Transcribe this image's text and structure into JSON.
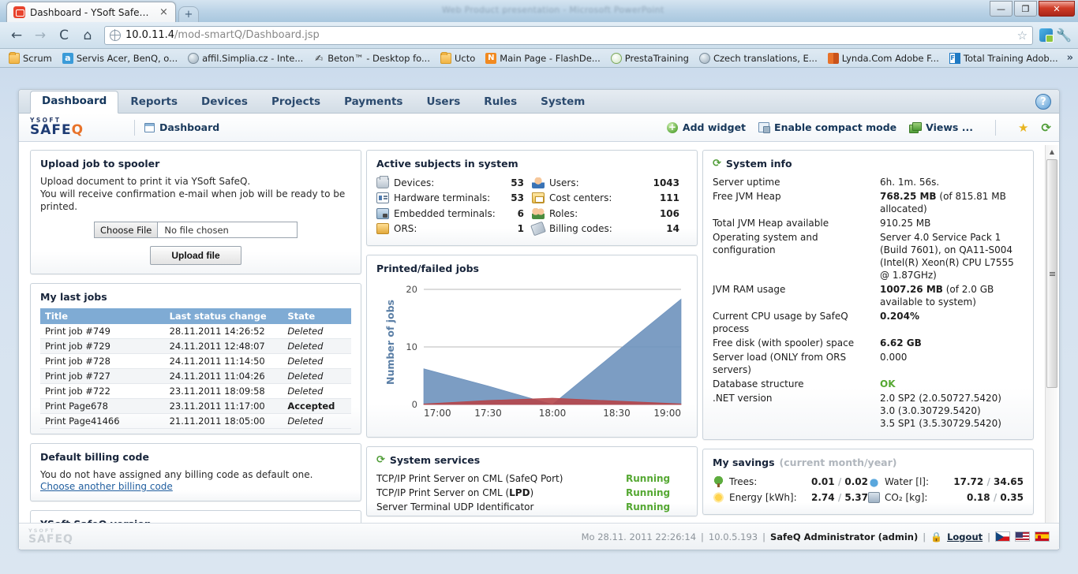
{
  "browser": {
    "tab_title": "Dashboard - YSoft SafeQ®",
    "tab_close": "×",
    "new_tab": "+",
    "ghost_window_title": "Web Product presentation - Microsoft PowerPoint",
    "window_minimize": "—",
    "window_restore": "❐",
    "window_close": "✕",
    "back": "←",
    "forward": "→",
    "reload": "C",
    "home": "⌂",
    "url_host": "10.0.11.4",
    "url_path": "/mod-smartQ/Dashboard.jsp",
    "star": "☆",
    "wrench": "🔧",
    "bookmarks_overflow": "»",
    "bookmarks": [
      {
        "label": "Scrum",
        "icon": "folder-icon",
        "glyph": ""
      },
      {
        "label": "Servis Acer, BenQ, o...",
        "icon": "amazon-icon",
        "glyph": "a"
      },
      {
        "label": "affil.Simplia.cz - Inte...",
        "icon": "globe-icon",
        "glyph": ""
      },
      {
        "label": "Beton™ - Desktop fo...",
        "icon": "hand-icon",
        "glyph": "✍"
      },
      {
        "label": "Ucto",
        "icon": "folder-icon",
        "glyph": ""
      },
      {
        "label": "Main Page - FlashDe...",
        "icon": "flash-icon",
        "glyph": "N"
      },
      {
        "label": "PrestaTraining",
        "icon": "presta-icon",
        "glyph": ""
      },
      {
        "label": "Czech translations, E...",
        "icon": "globe-icon",
        "glyph": ""
      },
      {
        "label": "Lynda.Com Adobe F...",
        "icon": "lynda-icon",
        "glyph": ""
      },
      {
        "label": "Total Training Adob...",
        "icon": "ft-icon",
        "glyph": "FT"
      }
    ]
  },
  "app": {
    "tabs": [
      {
        "label": "Dashboard",
        "active": true
      },
      {
        "label": "Reports",
        "active": false
      },
      {
        "label": "Devices",
        "active": false
      },
      {
        "label": "Projects",
        "active": false
      },
      {
        "label": "Payments",
        "active": false
      },
      {
        "label": "Users",
        "active": false
      },
      {
        "label": "Rules",
        "active": false
      },
      {
        "label": "System",
        "active": false
      }
    ],
    "help_label": "?",
    "logo_top": "YSOFT",
    "logo_bottom": "SAFEQ",
    "breadcrumb": "Dashboard",
    "toolbar": {
      "add_widget": "Add widget",
      "enable_compact_mode": "Enable compact mode",
      "views": "Views ..."
    }
  },
  "upload_widget": {
    "title": "Upload job to spooler",
    "line1": "Upload document to print it via YSoft SafeQ.",
    "line2": "You will receive confirmation e-mail when job will be ready to be printed.",
    "choose_file_label": "Choose File",
    "file_name": "No file chosen",
    "upload_button": "Upload file"
  },
  "last_jobs": {
    "title": "My last jobs",
    "columns": [
      "Title",
      "Last status change",
      "State"
    ],
    "rows": [
      {
        "title": "Print job #749",
        "changed": "28.11.2011 14:26:52",
        "state": "Deleted",
        "accepted": false
      },
      {
        "title": "Print job #729",
        "changed": "24.11.2011 12:48:07",
        "state": "Deleted",
        "accepted": false
      },
      {
        "title": "Print job #728",
        "changed": "24.11.2011 11:14:50",
        "state": "Deleted",
        "accepted": false
      },
      {
        "title": "Print job #727",
        "changed": "24.11.2011 11:04:26",
        "state": "Deleted",
        "accepted": false
      },
      {
        "title": "Print job #722",
        "changed": "23.11.2011 18:09:58",
        "state": "Deleted",
        "accepted": false
      },
      {
        "title": "Print Page678",
        "changed": "23.11.2011 11:17:00",
        "state": "Accepted",
        "accepted": true
      },
      {
        "title": "Print Page41466",
        "changed": "21.11.2011 18:05:00",
        "state": "Deleted",
        "accepted": false
      }
    ]
  },
  "billing_widget": {
    "title": "Default billing code",
    "text": "You do not have assigned any billing code as default one.",
    "link": "Choose another billing code"
  },
  "version_widget": {
    "title": "YSoft SafeQ version"
  },
  "active_subjects": {
    "title": "Active subjects in system",
    "left": [
      {
        "label": "Devices:",
        "value": "53",
        "icon": "printer-icon"
      },
      {
        "label": "Hardware terminals:",
        "value": "53",
        "icon": "card-reader-icon"
      },
      {
        "label": "Embedded terminals:",
        "value": "6",
        "icon": "embedded-terminal-icon"
      },
      {
        "label": "ORS:",
        "value": "1",
        "icon": "ors-icon"
      }
    ],
    "right": [
      {
        "label": "Users:",
        "value": "1043",
        "icon": "user-icon"
      },
      {
        "label": "Cost centers:",
        "value": "111",
        "icon": "cost-center-icon"
      },
      {
        "label": "Roles:",
        "value": "106",
        "icon": "roles-icon"
      },
      {
        "label": "Billing codes:",
        "value": "14",
        "icon": "tag-icon"
      }
    ]
  },
  "chart_data": {
    "type": "area",
    "title": "Printed/failed jobs",
    "xlabel": "",
    "ylabel": "Number of jobs",
    "x": [
      "17:00",
      "17:30",
      "18:00",
      "18:30",
      "19:00"
    ],
    "tick_labels_x": [
      "17:00",
      "17:30",
      "18:00",
      "18:30",
      "19:00"
    ],
    "tick_labels_y": [
      "0",
      "10",
      "20"
    ],
    "ylim": [
      0,
      20
    ],
    "grid": true,
    "legend": "none",
    "series": [
      {
        "name": "Printed",
        "color": "#6e92bd",
        "values": [
          6.2,
          3.2,
          0.0,
          9.2,
          18.3
        ]
      },
      {
        "name": "Failed",
        "color": "#b5464a",
        "values": [
          0.1,
          0.7,
          1.1,
          0.6,
          0.1
        ]
      }
    ]
  },
  "system_info": {
    "title": "System info",
    "rows": [
      {
        "key": "Server uptime",
        "value": "6h. 1m. 56s.",
        "bold": ""
      },
      {
        "key": "Free JVM Heap",
        "value": " (of 815.81 MB allocated)",
        "bold": "768.25 MB"
      },
      {
        "key": "Total JVM Heap available",
        "value": "910.25 MB",
        "bold": ""
      },
      {
        "key": "Operating system and configuration",
        "value": "Server 4.0 Service Pack 1 (Build 7601), on QA11-S004 (Intel(R) Xeon(R) CPU L7555 @ 1.87GHz)",
        "bold": ""
      },
      {
        "key": "JVM RAM usage",
        "value": " (of 2.0 GB available to system)",
        "bold": "1007.26 MB"
      },
      {
        "key": "Current CPU usage by SafeQ process",
        "value": "",
        "bold": "0.204%"
      },
      {
        "key": "Free disk (with spooler) space",
        "value": "",
        "bold": "6.62 GB"
      },
      {
        "key": "Server load (ONLY from ORS servers)",
        "value": "0.000",
        "bold": ""
      },
      {
        "key": "Database structure",
        "value": "OK",
        "bold": "",
        "ok": true
      },
      {
        "key": ".NET version",
        "value": "2.0 SP2 (2.0.50727.5420)\n3.0 (3.0.30729.5420)\n3.5 SP1 (3.5.30729.5420)",
        "bold": ""
      }
    ]
  },
  "savings": {
    "title": "My savings",
    "subtitle": "(current month/year)",
    "left": [
      {
        "label": "Trees:",
        "month": "0.01",
        "year": "0.02",
        "icon": "tree-icon"
      },
      {
        "label": "Energy [kWh]:",
        "month": "2.74",
        "year": "5.37",
        "icon": "sun-icon"
      }
    ],
    "right": [
      {
        "label": "Water [l]:",
        "month": "17.72",
        "year": "34.65",
        "icon": "water-icon"
      },
      {
        "label": "CO₂ [kg]:",
        "month": "0.18",
        "year": "0.35",
        "icon": "co2-icon"
      }
    ],
    "separator": "/"
  },
  "services": {
    "title": "System services",
    "rows": [
      {
        "name": "TCP/IP Print Server on CML (SafeQ Port)",
        "status": "Running"
      },
      {
        "name": "TCP/IP Print Server on CML (LPD)",
        "status": "Running"
      },
      {
        "name": "Server Terminal UDP Identificator",
        "status": "Running"
      }
    ]
  },
  "footer": {
    "logo_top": "YSOFT",
    "logo_bottom": "SAFEQ",
    "datetime": "Mo 28.11. 2011 22:26:14",
    "ip": "10.0.5.193",
    "user": "SafeQ Administrator (admin)",
    "logout": "Logout",
    "sep": "|",
    "flags": [
      "cz",
      "us",
      "es"
    ]
  }
}
